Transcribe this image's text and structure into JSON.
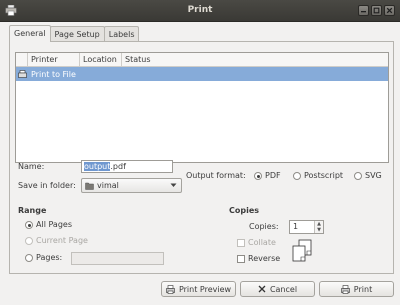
{
  "window": {
    "title": "Print"
  },
  "tabs": [
    {
      "label": "General",
      "active": true
    },
    {
      "label": "Page Setup",
      "active": false
    },
    {
      "label": "Labels",
      "active": false
    }
  ],
  "printer_list": {
    "columns": [
      "Printer",
      "Location",
      "Status"
    ],
    "rows": [
      {
        "name": "Print to File",
        "location": "",
        "status": "",
        "selected": true
      }
    ]
  },
  "file": {
    "name_label": "Name:",
    "name_selected": "output",
    "name_rest": ".pdf",
    "folder_label": "Save in folder:",
    "folder_value": "vimal"
  },
  "output_format": {
    "label": "Output format:",
    "options": [
      "PDF",
      "Postscript",
      "SVG"
    ],
    "selected": "PDF"
  },
  "range": {
    "title": "Range",
    "all_pages": "All Pages",
    "current_page": "Current Page",
    "pages": "Pages:",
    "pages_value": "",
    "selected": "All Pages"
  },
  "copies": {
    "title": "Copies",
    "copies_label": "Copies:",
    "copies_value": "1",
    "collate_label": "Collate",
    "collate_checked": false,
    "reverse_label": "Reverse",
    "reverse_checked": false
  },
  "buttons": {
    "preview": "Print Preview",
    "cancel": "Cancel",
    "print": "Print"
  },
  "colors": {
    "selection": "#86abd9",
    "titlebar": "#3c3b37",
    "background": "#f2f1f0"
  }
}
